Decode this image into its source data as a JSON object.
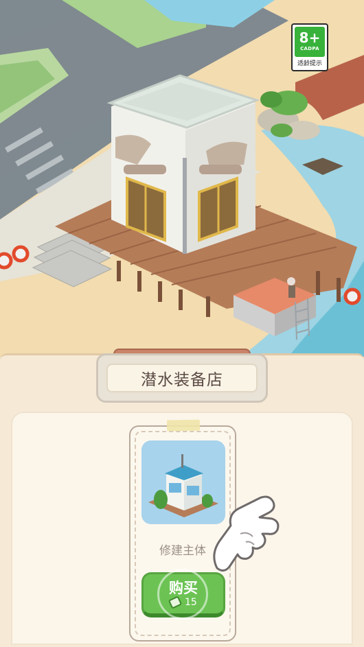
{
  "age_rating": {
    "number": "8+",
    "org": "CADPA",
    "tip": "适龄提示"
  },
  "shop": {
    "title": "潜水装备店"
  },
  "card": {
    "label": "修建主体",
    "buy_label": "购买",
    "price": "15",
    "currency_icon": "coupon-icon"
  },
  "scene": {
    "building": "dive-shop-building",
    "pier": "wooden-pier"
  },
  "colors": {
    "button_green": "#6cc354",
    "panel_bg": "#f6ead6",
    "sand": "#f2dcb0",
    "road": "#7f8a90"
  }
}
